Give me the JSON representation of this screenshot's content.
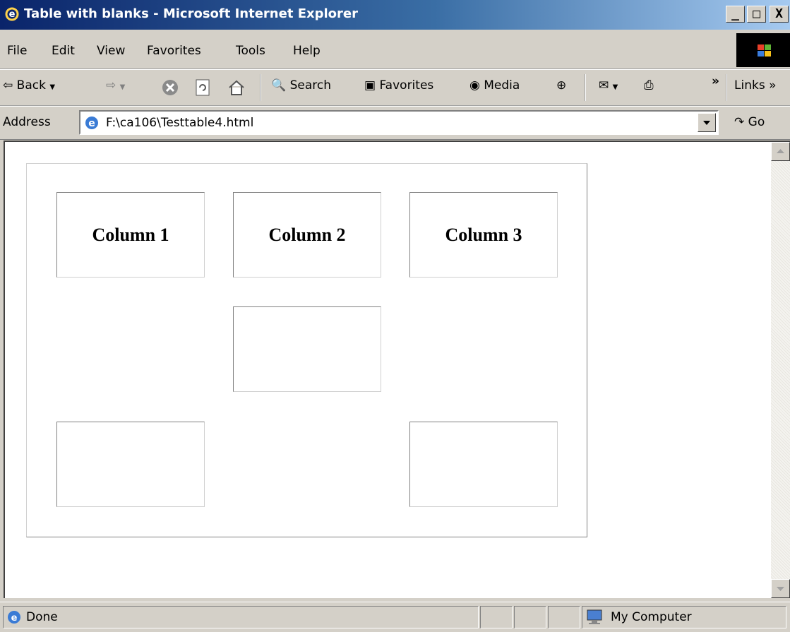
{
  "window": {
    "title": "Table with blanks - Microsoft Internet Explorer",
    "min_label": "_",
    "max_label": "□",
    "close_label": "X"
  },
  "menu": [
    "File",
    "Edit",
    "View",
    "Favorites",
    "Tools",
    "Help"
  ],
  "toolbar": {
    "back_label": "Back",
    "search_label": "Search",
    "favorites_label": "Favorites",
    "media_label": "Media",
    "overflow_label": "»",
    "links_label": "Links »"
  },
  "address": {
    "label": "Address",
    "value": "F:\\ca106\\Testtable4.html",
    "go_label": "Go"
  },
  "table": {
    "headers": [
      "Column 1",
      "Column 2",
      "Column 3"
    ]
  },
  "status": {
    "text": "Done",
    "zone": "My Computer"
  },
  "colors": {
    "title_gradient_start": "#0a246a",
    "title_gradient_end": "#a6caf0",
    "chrome": "#d4d0c8"
  }
}
